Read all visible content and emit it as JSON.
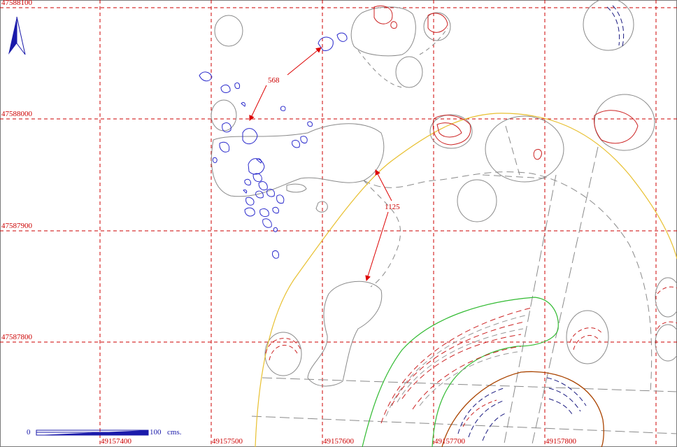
{
  "map": {
    "colors": {
      "grid": "#cc0000",
      "label": "#cc0000",
      "arrow": "#dd0000",
      "blue_features": "#2a2acc",
      "grey_features": "#8a8a8a",
      "yellow_boundary": "#e8c030",
      "green_boundary": "#33bb33",
      "brown_boundary": "#aa4400",
      "north_arrow": "#1a1aaa"
    },
    "grid_y_labels": [
      "47588100",
      "47588000",
      "47587900",
      "47587800"
    ],
    "grid_x_labels": [
      "49157400",
      "49157500",
      "49157600",
      "49157700",
      "49157800"
    ],
    "annotations": {
      "label_a": "568",
      "label_b": "1125"
    },
    "scale_bar": {
      "start": "0",
      "end": "100",
      "unit": "cms."
    },
    "north_arrow_icon": "north-arrow-icon"
  }
}
